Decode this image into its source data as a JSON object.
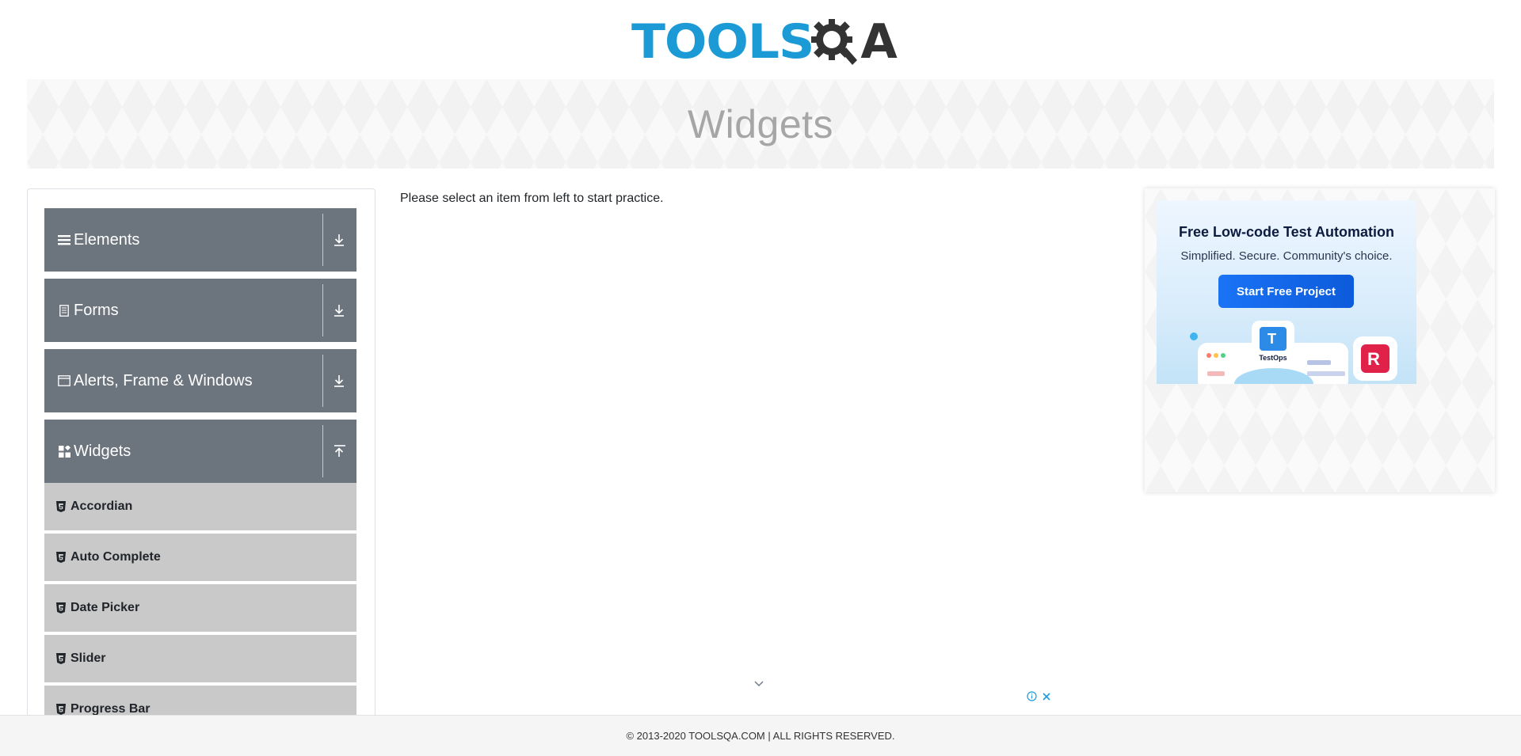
{
  "header": {
    "logo": {
      "text_main": "TOOLS",
      "text_end": "A",
      "colors": {
        "blue": "#1b9ad6",
        "dark": "#333333"
      }
    }
  },
  "banner": {
    "title": "Widgets"
  },
  "sidebar": {
    "groups": [
      {
        "label": "Elements",
        "icon": "hamburger-icon",
        "expanded": false
      },
      {
        "label": "Forms",
        "icon": "document-icon",
        "expanded": false
      },
      {
        "label": "Alerts, Frame & Windows",
        "icon": "window-icon",
        "expanded": false
      },
      {
        "label": "Widgets",
        "icon": "widgets-icon",
        "expanded": true
      }
    ],
    "widget_items": [
      {
        "label": "Accordian"
      },
      {
        "label": "Auto Complete"
      },
      {
        "label": "Date Picker"
      },
      {
        "label": "Slider"
      },
      {
        "label": "Progress Bar"
      }
    ]
  },
  "main": {
    "message": "Please select an item from left to start practice."
  },
  "ad": {
    "title": "Free Low-code Test Automation",
    "subtitle": "Simplified. Secure. Community's choice.",
    "button": "Start Free Project",
    "badge_label": "TestOps",
    "badge_letter_left": "T",
    "badge_letter_right": "R"
  },
  "footer": {
    "text": "© 2013-2020 TOOLSQA.COM | ALL RIGHTS RESERVED."
  },
  "colors": {
    "group_bg": "#6c757d",
    "item_bg": "#c9c9c9",
    "ad_button": "#1a73f5"
  }
}
